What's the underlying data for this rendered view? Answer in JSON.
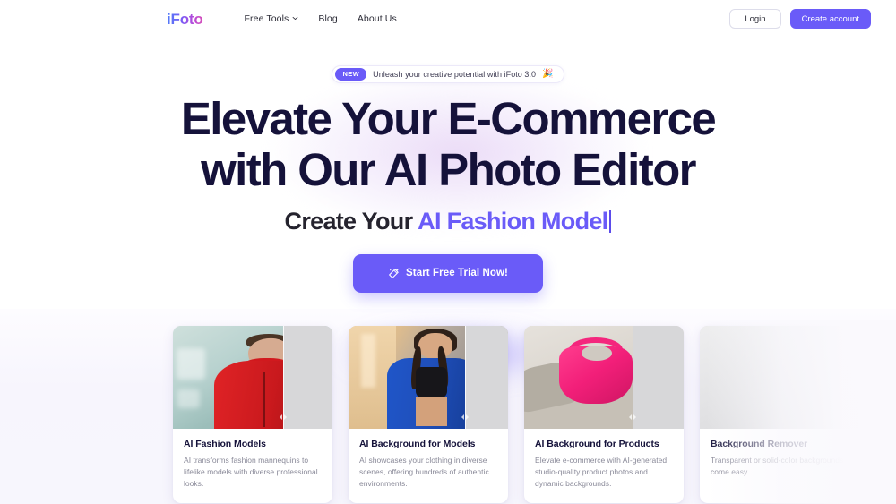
{
  "header": {
    "logo": "iFoto",
    "nav": [
      {
        "label": "Free Tools",
        "has_dropdown": true,
        "icon": "chevron-down-icon"
      },
      {
        "label": "Blog",
        "has_dropdown": false
      },
      {
        "label": "About Us",
        "has_dropdown": false
      }
    ],
    "login_label": "Login",
    "create_account_label": "Create account"
  },
  "hero": {
    "badge": {
      "pill": "NEW",
      "text": "Unleash your creative potential with iFoto 3.0",
      "emoji": "🎉"
    },
    "headline_line1": "Elevate Your E-Commerce",
    "headline_line2": "with Our AI Photo Editor",
    "subline_static": "Create Your ",
    "subline_accent": "AI Fashion Model",
    "cta_label": "Start Free Trial Now!",
    "cta_icon": "magic-wand-icon"
  },
  "cards": [
    {
      "title": "AI Fashion Models",
      "description": "AI transforms fashion mannequins to lifelike models with diverse professional looks.",
      "image": "man-in-red-jacket"
    },
    {
      "title": "AI Background for Models",
      "description": "AI showcases your clothing in diverse scenes, offering hundreds of authentic environments.",
      "image": "woman-in-blue-jacket"
    },
    {
      "title": "AI Background for Products",
      "description": "Elevate e-commerce with AI-generated studio-quality product photos and dynamic backgrounds.",
      "image": "pink-handbag-on-sofa"
    },
    {
      "title": "Background Remover",
      "description": "Transparent or solid-color backgrounds come easy.",
      "image": "placeholder-grey"
    }
  ],
  "colors": {
    "accent": "#6a5bf8",
    "headline": "#15123a",
    "muted_text": "#8a8a99",
    "page_bg": "#ffffff",
    "lower_bg": "#f7f6fd"
  }
}
